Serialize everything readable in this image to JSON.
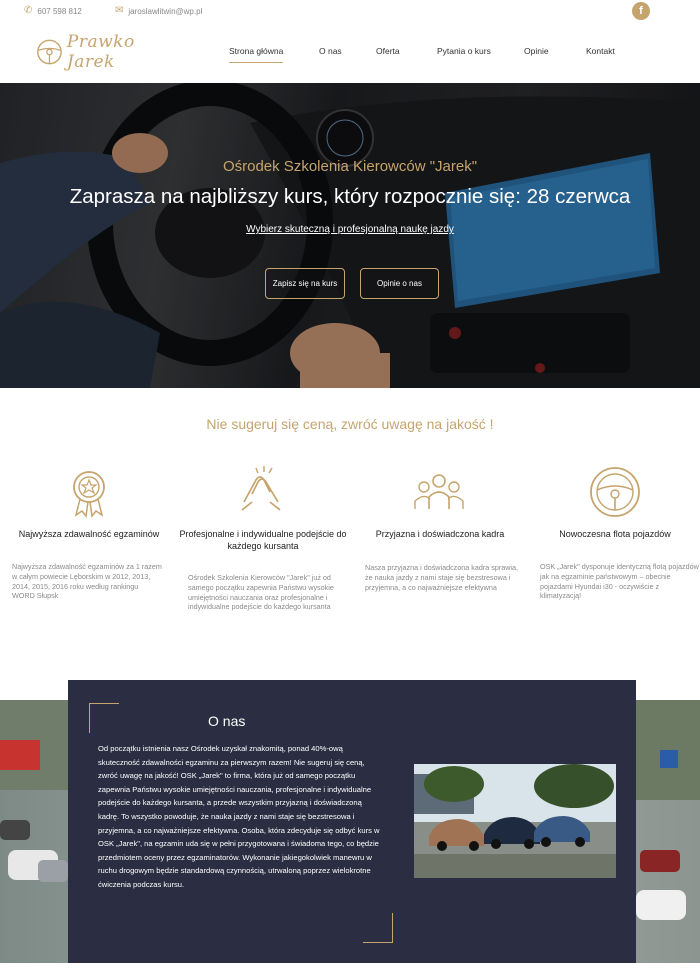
{
  "topbar": {
    "phone": "607 598 812",
    "email": "jaroslawlitwin@wp.pl",
    "facebook_icon": "facebook-icon"
  },
  "logo": {
    "text": "Prawko Jarek"
  },
  "nav": {
    "items": [
      {
        "label": "Strona główna",
        "active": true
      },
      {
        "label": "O nas",
        "active": false
      },
      {
        "label": "Oferta",
        "active": false
      },
      {
        "label": "Pytania o kurs",
        "active": false
      },
      {
        "label": "Opinie",
        "active": false
      },
      {
        "label": "Kontakt",
        "active": false
      }
    ]
  },
  "hero": {
    "subtitle": "Ośrodek Szkolenia Kierowców \"Jarek\"",
    "title": "Zaprasza na najbliższy kurs, który rozpocznie się: 28 czerwca",
    "link": "Wybierz skuteczną i profesjonalną naukę jazdy",
    "button_signup": "Zapisz się na kurs",
    "button_reviews": "Opinie o nas"
  },
  "features": {
    "tagline": "Nie sugeruj się ceną, zwróć uwagę na jakość !",
    "items": [
      {
        "icon": "award-icon",
        "title": "Najwyższa zdawalność egzaminów",
        "desc": "Najwyższa zdawalność egzaminów za 1 razem w całym powiecie Lęborskim w 2012, 2013, 2014, 2015, 2016 roku według rankingu WORD Słupsk"
      },
      {
        "icon": "handshake-icon",
        "title": "Profesjonalne i indywidualne podejście do każdego kursanta",
        "desc": "Ośrodek Szkolenia Kierowców \"Jarek\" już od samego początku zapewnia Państwu wysokie umiejętności nauczania oraz profesjonalne i indywidualne podejście do każdego kursanta"
      },
      {
        "icon": "team-icon",
        "title": "Przyjazna i doświadczona kadra",
        "desc": "Nasza przyjazna i doświadczona kadra sprawia, że nauka jazdy z nami staje się bezstresowa i przyjemna, a co najważniejsze efektywna"
      },
      {
        "icon": "steering-wheel-icon",
        "title": "Nowoczesna flota pojazdów",
        "desc": "OSK „Jarek\" dysponuje identyczną flotą pojazdów jak na egzaminie państwowym – obecnie pojazdami Hyundai i30 - oczywiście z klimatyzacją!"
      }
    ]
  },
  "about": {
    "title": "O nas",
    "text": "Od początku istnienia nasz Ośrodek uzyskał znakomitą, ponad 40%-ową skuteczność zdawalności egzaminu za pierwszym razem! Nie sugeruj się ceną, zwróć uwagę na jakość! OSK „Jarek\" to firma, która już od samego początku zapewnia Państwu wysokie umiejętności nauczania, profesjonalne i indywidualne podejście do każdego kursanta, a przede wszystkim przyjazną i doświadczoną kadrę. To wszystko powoduje, że nauka jazdy z nami staje się bezstresowa i przyjemna, a co najważniejsze efektywna. Osoba, która zdecyduje się odbyć kurs w OSK „Jarek\", na egzamin uda się w pełni przygotowana i świadoma tego, co będzie przedmiotem oceny przez egzaminatorów. Wykonanie jakiegokolwiek manewru w ruchu drogowym będzie standardową czynnością, utrwaloną poprzez wielokrotne ćwiczenia podczas kursu."
  },
  "colors": {
    "accent": "#c6a46d",
    "dark": "#2b2e43"
  }
}
